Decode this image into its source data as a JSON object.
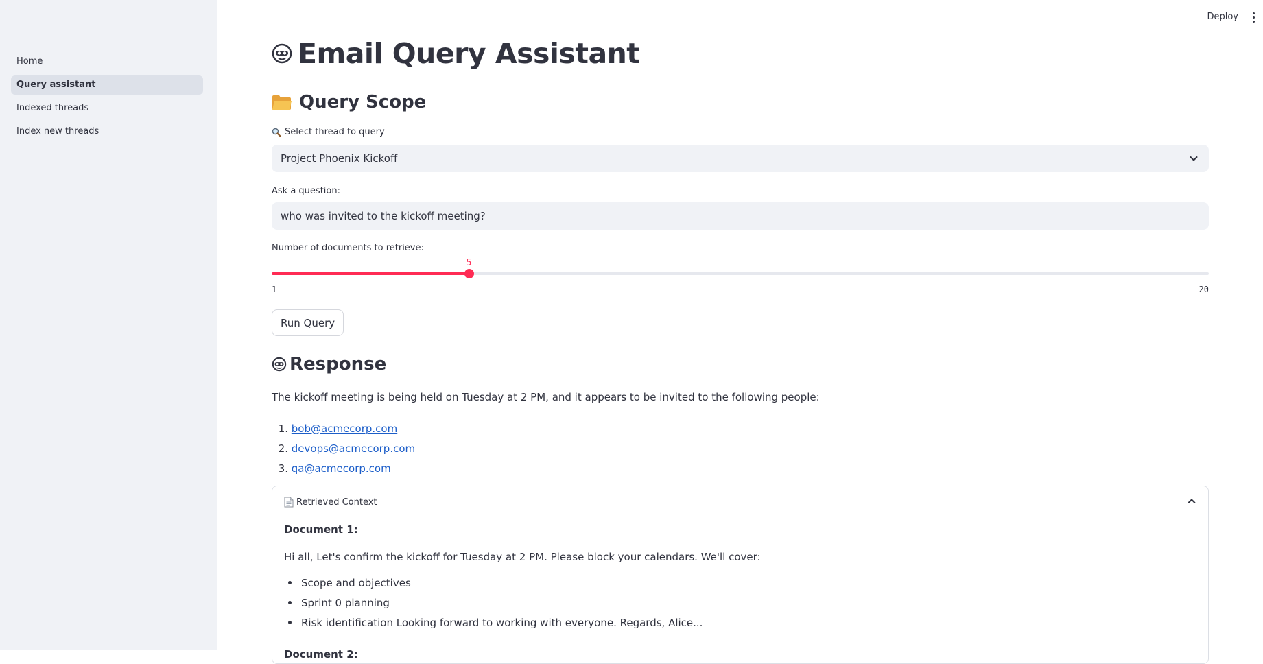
{
  "header": {
    "deploy_label": "Deploy"
  },
  "sidebar": {
    "items": [
      {
        "label": "Home",
        "active": false
      },
      {
        "label": "Query assistant",
        "active": true
      },
      {
        "label": "Indexed threads",
        "active": false
      },
      {
        "label": "Index new threads",
        "active": false
      }
    ]
  },
  "main": {
    "title": "Email Query Assistant",
    "title_icon": "ghost-icon",
    "query_scope": {
      "heading": "Query Scope",
      "heading_icon": "folder-icon",
      "select_label": "Select thread to query",
      "select_icon": "magnifier-icon",
      "selected_thread": "Project Phoenix Kickoff",
      "question_label": "Ask a question:",
      "question_value": "who was invited to the kickoff meeting?",
      "slider_label": "Number of documents to retrieve:",
      "slider_value": "5",
      "slider_fraction": 0.2105,
      "slider_min": "1",
      "slider_max": "20",
      "run_button": "Run Query"
    },
    "response": {
      "heading": "Response",
      "heading_icon": "ghost-icon",
      "intro": "The kickoff meeting is being held on Tuesday at 2 PM, and it appears to be invited to the following people:",
      "invitees": [
        {
          "num": "1.",
          "email": "bob@acmecorp.com"
        },
        {
          "num": "2.",
          "email": "devops@acmecorp.com"
        },
        {
          "num": "3.",
          "email": "qa@acmecorp.com"
        }
      ]
    },
    "context": {
      "label": "Retrieved Context",
      "label_icon": "document-icon",
      "doc1_title": "Document 1:",
      "doc1_text": "Hi all, Let's confirm the kickoff for Tuesday at 2 PM. Please block your calendars. We'll cover:",
      "doc1_bullets": [
        "Scope and objectives",
        "Sprint 0 planning",
        "Risk identification Looking forward to working with everyone. Regards, Alice..."
      ],
      "doc2_title": "Document 2:"
    }
  },
  "colors": {
    "accent": "#ff2b54",
    "link": "#1c5ec9",
    "sidebar_bg": "#f0f2f6",
    "text": "#31333f"
  }
}
